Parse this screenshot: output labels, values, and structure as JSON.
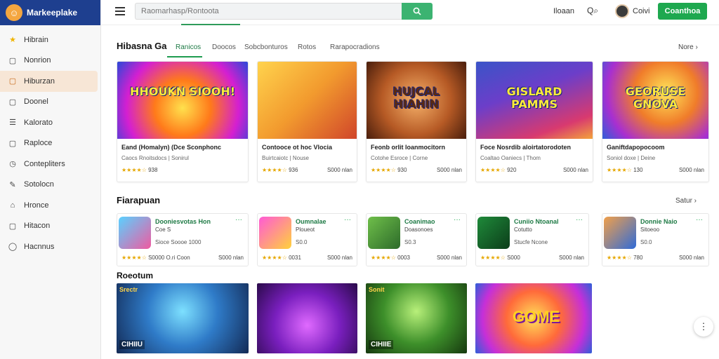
{
  "brand": {
    "name": "Markeeplake"
  },
  "sidebar": {
    "items": [
      {
        "label": "Hibrain",
        "icon": "star-icon"
      },
      {
        "label": "Nonrion",
        "icon": "document-icon"
      },
      {
        "label": "Hiburzan",
        "icon": "document-icon"
      },
      {
        "label": "Doonel",
        "icon": "document-icon"
      },
      {
        "label": "Kalorato",
        "icon": "list-icon"
      },
      {
        "label": "Raploce",
        "icon": "document-icon"
      },
      {
        "label": "Contepliters",
        "icon": "clock-icon"
      },
      {
        "label": "Sotolocn",
        "icon": "pen-icon"
      },
      {
        "label": "Hronce",
        "icon": "lock-icon"
      },
      {
        "label": "Hitacon",
        "icon": "document-icon"
      },
      {
        "label": "Hacnnus",
        "icon": "circle-icon"
      }
    ],
    "active_index": 2
  },
  "topbar": {
    "search_placeholder": "Raomarhasp/Rontoota",
    "link": "Iloaan",
    "search_icon_label": "Q",
    "user_name": "Coivi",
    "cta": "Coanthoa"
  },
  "featured": {
    "title": "Hibasna Ga",
    "tabs": [
      "Ranicos",
      "Doocos",
      "Sobcbonturos",
      "Rotos",
      "Rarapocradions"
    ],
    "active_tab": 0,
    "more": "Nore",
    "cards": [
      {
        "image_text": "HHOUKN SIOOH!",
        "title": "Eand (Homalyn) (Dce Sconphonc",
        "sub": "Caocs Rnoitsdocs | Sonirul",
        "stars": "★★★★☆",
        "rating": "938",
        "price": ""
      },
      {
        "image_text": "",
        "title": "Contooce ot hoc Vlocia",
        "sub": "Buirtcaiotc | Nouse",
        "stars": "★★★★☆",
        "rating": "936",
        "price": "S000 nlan"
      },
      {
        "image_text": "HUJCAL HIAHIN",
        "title": "Feonb orlit loanmocitorn",
        "sub": "Cotohe Esroce | Corne",
        "stars": "★★★★☆",
        "rating": "930",
        "price": "S000 nlan"
      },
      {
        "image_text": "GISLARD PAMMS",
        "title": "Foce Nosrdib aloirtatorodoten",
        "sub": "Coaltao Oaniecs | Thom",
        "stars": "★★★★☆",
        "rating": "920",
        "price": "S000 nlan"
      },
      {
        "image_text": "GEORUSE GNOVA",
        "title": "Ganiftdapopocoom",
        "sub": "Soniol doxe | Deine",
        "stars": "★★★★☆",
        "rating": "130",
        "price": "S000 nlan"
      }
    ]
  },
  "popular": {
    "title": "Fiarapuan",
    "more": "Satur",
    "items": [
      {
        "name": "Dooniesvotas Hon",
        "line2": "Coe S",
        "line3": "Sioce Soooe 1000",
        "stars": "★★★★☆",
        "rating": "S0000",
        "extra": "O.ri Coon",
        "price": "S000 nlan"
      },
      {
        "name": "Oumnalae",
        "line2": "Ploueot",
        "line3": "S0.0",
        "stars": "★★★★☆",
        "rating": "0031",
        "extra": "",
        "price": "S000 nlan"
      },
      {
        "name": "Coanimao",
        "line2": "Doasonoes",
        "line3": "S0.3",
        "stars": "★★★★☆",
        "rating": "0003",
        "extra": "",
        "price": "S000 nlan"
      },
      {
        "name": "Cuniio Ntoanal",
        "line2": "Cotutto",
        "line3": "Stucfe Ncone",
        "stars": "★★★★☆",
        "rating": "S000",
        "extra": "",
        "price": "S000 nlan"
      },
      {
        "name": "Donnie Naio",
        "line2": "Sitoeoo",
        "line3": "S0.0",
        "stars": "★★★★☆",
        "rating": "780",
        "extra": "",
        "price": "S000 nlan"
      }
    ]
  },
  "recent": {
    "title": "Roeotum",
    "tiles": [
      {
        "tag": "Srectr",
        "label": "CIHIIU"
      },
      {
        "tag": "",
        "label": ""
      },
      {
        "tag": "Sonit",
        "label": "CIHIIE"
      },
      {
        "tag": "",
        "label": "GOME"
      }
    ]
  },
  "fab": {
    "icon": "more-vertical-icon",
    "glyph": "⋮"
  }
}
